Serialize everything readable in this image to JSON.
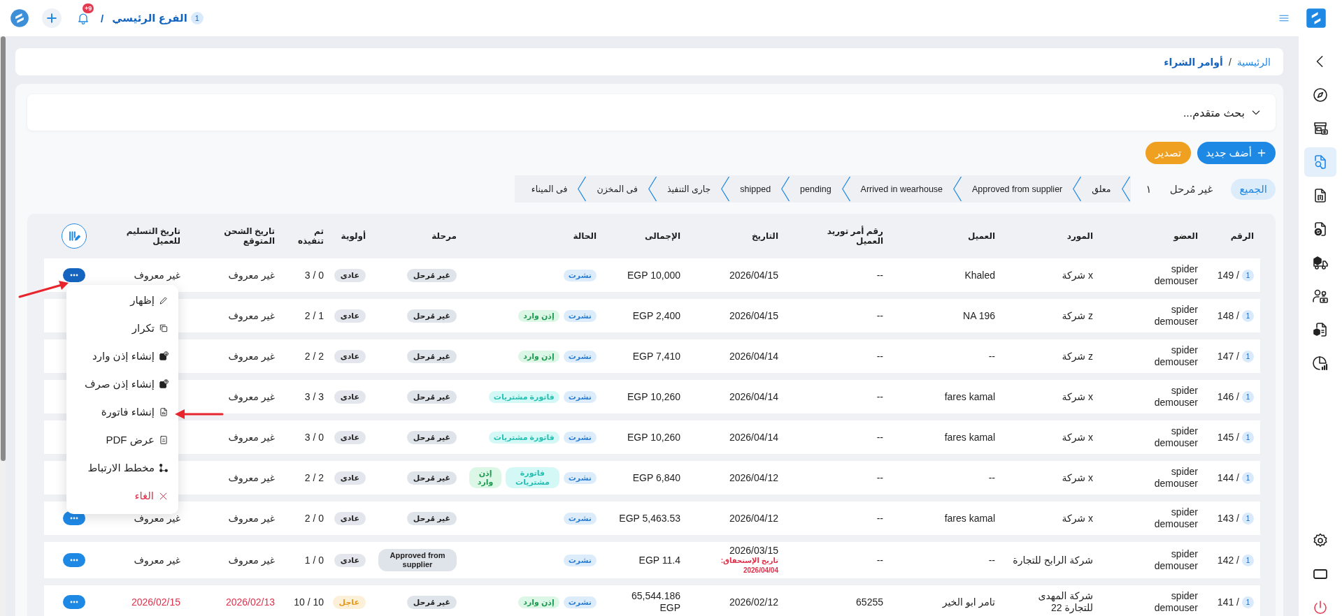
{
  "top_bar": {
    "notification_count": "+9",
    "separator": "/",
    "branch": "الفرع الرئيسي",
    "branch_count": "1"
  },
  "breadcrumb": {
    "items": [
      {
        "label": "الرئيسية",
        "kind": "link"
      },
      {
        "label": "أوامر الشراء",
        "kind": "current"
      }
    ],
    "separator": "/"
  },
  "advanced_search": {
    "label": "بحث متقدم...",
    "expanded": false
  },
  "toolbar": [
    {
      "label": "أضف جديد",
      "kind": "add"
    },
    {
      "label": "تصدير",
      "kind": "export"
    }
  ],
  "filters": {
    "tabs": [
      {
        "label": "الجميع",
        "selected": true
      },
      {
        "label": "غير مُرحل",
        "selected": false,
        "count": "١"
      }
    ],
    "steps": [
      {
        "label": "معلق",
        "selected": false
      },
      {
        "label": "Approved from supplier",
        "selected": false
      },
      {
        "label": "Arrived in wearhouse",
        "selected": false
      },
      {
        "label": "pending",
        "selected": false
      },
      {
        "label": "shipped",
        "selected": false
      },
      {
        "label": "جارى التنفيذ",
        "selected": false
      },
      {
        "label": "فى المخزن",
        "selected": false
      },
      {
        "label": "فى الميناء",
        "selected": false
      }
    ]
  },
  "table": {
    "columns": [
      "الرقم",
      "العضو",
      "المورد",
      "العميل",
      "رقم أمر توريد العميل",
      "التاريخ",
      "الإجمالى",
      "الحالة",
      "مرحلة",
      "أولوية",
      "تم تنفيذه",
      "تاريخ الشحن المتوقع",
      "تاريخ التسليم للعميل"
    ],
    "rows": [
      {
        "number": "149 /",
        "badge": "1",
        "member": "spider demouser",
        "supplier": "شركة x",
        "customer": "Khaled",
        "customer_order": "--",
        "date": "2026/04/15",
        "total": "EGP 10,000",
        "tags": [
          {
            "label": "نشرت",
            "kind": "published"
          }
        ],
        "stage": {
          "label": "غير مُرحل",
          "kind": "plain"
        },
        "priority": {
          "label": "عادى",
          "kind": "normal"
        },
        "done": "3 / 0",
        "shipping_date": "غير معروف",
        "delivery_date": "غير معروف",
        "overdue": false,
        "menu_open": true
      },
      {
        "number": "148 /",
        "badge": "1",
        "member": "spider demouser",
        "supplier": "شركة z",
        "customer": "NA 196",
        "customer_order": "--",
        "date": "2026/04/15",
        "total": "EGP 2,400",
        "tags": [
          {
            "label": "نشرت",
            "kind": "published"
          },
          {
            "label": "إذن وارد",
            "kind": "receipt"
          }
        ],
        "stage": {
          "label": "غير مُرحل",
          "kind": "plain"
        },
        "priority": {
          "label": "عادى",
          "kind": "normal"
        },
        "done": "2 / 1",
        "shipping_date": "غير معروف",
        "overdue": false
      },
      {
        "number": "147 /",
        "badge": "1",
        "member": "spider demouser",
        "supplier": "شركة z",
        "customer": "--",
        "customer_order": "--",
        "date": "2026/04/14",
        "total": "EGP 7,410",
        "tags": [
          {
            "label": "نشرت",
            "kind": "published"
          },
          {
            "label": "إذن وارد",
            "kind": "receipt"
          }
        ],
        "stage": {
          "label": "غير مُرحل",
          "kind": "plain"
        },
        "priority": {
          "label": "عادى",
          "kind": "normal"
        },
        "done": "2 / 2",
        "shipping_date": "غير معروف",
        "overdue": false
      },
      {
        "number": "146 /",
        "badge": "1",
        "member": "spider demouser",
        "supplier": "شركة x",
        "customer": "fares kamal",
        "customer_order": "--",
        "date": "2026/04/14",
        "total": "EGP 10,260",
        "tags": [
          {
            "label": "نشرت",
            "kind": "published"
          },
          {
            "label": "فاتورة مشتريات",
            "kind": "invoice"
          }
        ],
        "stage": {
          "label": "غير مُرحل",
          "kind": "plain"
        },
        "priority": {
          "label": "عادى",
          "kind": "normal"
        },
        "done": "3 / 3",
        "shipping_date": "غير معروف",
        "overdue": false
      },
      {
        "number": "145 /",
        "badge": "1",
        "member": "spider demouser",
        "supplier": "شركة x",
        "customer": "fares kamal",
        "customer_order": "--",
        "date": "2026/04/14",
        "total": "EGP 10,260",
        "tags": [
          {
            "label": "نشرت",
            "kind": "published"
          },
          {
            "label": "فاتورة مشتريات",
            "kind": "invoice"
          }
        ],
        "stage": {
          "label": "غير مُرحل",
          "kind": "plain"
        },
        "priority": {
          "label": "عادى",
          "kind": "normal"
        },
        "done": "3 / 0",
        "shipping_date": "غير معروف",
        "overdue": false
      },
      {
        "number": "144 /",
        "badge": "1",
        "member": "spider demouser",
        "supplier": "شركة x",
        "customer": "--",
        "customer_order": "--",
        "date": "2026/04/12",
        "total": "EGP 6,840",
        "tags": [
          {
            "label": "نشرت",
            "kind": "published"
          },
          {
            "label": "فاتورة مشتريات",
            "kind": "invoice"
          },
          {
            "label": "إذن وارد",
            "kind": "receipt"
          }
        ],
        "stage": {
          "label": "غير مُرحل",
          "kind": "plain"
        },
        "priority": {
          "label": "عادى",
          "kind": "normal"
        },
        "done": "2 / 2",
        "shipping_date": "غير معروف",
        "overdue": false
      },
      {
        "number": "143 /",
        "badge": "1",
        "member": "spider demouser",
        "supplier": "شركة x",
        "customer": "fares kamal",
        "customer_order": "--",
        "date": "2026/04/12",
        "total": "EGP 5,463.53",
        "tags": [
          {
            "label": "نشرت",
            "kind": "published"
          }
        ],
        "stage": {
          "label": "غير مُرحل",
          "kind": "plain"
        },
        "priority": {
          "label": "عادى",
          "kind": "normal"
        },
        "done": "2 / 0",
        "shipping_date": "غير معروف",
        "delivery_date": "غير معروف",
        "overdue": false,
        "menu_open": false
      },
      {
        "number": "142 /",
        "badge": "1",
        "member": "spider demouser",
        "supplier": "شركة الرابح للتجارة",
        "customer": "--",
        "customer_order": "--",
        "date": "2026/03/15",
        "due_label": "تاريخ الإستحقاق:",
        "due_date": "2026/04/04",
        "total": "EGP 11.4",
        "tags": [
          {
            "label": "نشرت",
            "kind": "published"
          }
        ],
        "stage": {
          "label": "Approved from supplier",
          "kind": "approved"
        },
        "priority": {
          "label": "عادى",
          "kind": "normal"
        },
        "done": "1 / 0",
        "shipping_date": "غير معروف",
        "delivery_date": "غير معروف",
        "overdue": false,
        "menu_open": false
      },
      {
        "number": "141 /",
        "badge": "1",
        "member": "spider demouser",
        "supplier": "شركة المهدى للتجارة 22",
        "customer": "تامر ابو الخير",
        "customer_order": "65255",
        "date": "2026/02/12",
        "total": "65,544.186 EGP",
        "tags": [
          {
            "label": "نشرت",
            "kind": "published"
          },
          {
            "label": "إذن وارد",
            "kind": "receipt"
          }
        ],
        "stage": {
          "label": "غير مُرحل",
          "kind": "plain"
        },
        "priority": {
          "label": "عاجل",
          "kind": "urgent"
        },
        "done": "10 / 10",
        "shipping_date": "2026/02/13",
        "delivery_date": "2026/02/15",
        "overdue": true,
        "menu_open": false
      }
    ]
  },
  "row_menu": {
    "items": [
      {
        "label": "إظهار",
        "kind": "normal"
      },
      {
        "label": "تكرار",
        "kind": "normal"
      },
      {
        "label": "إنشاء إذن وارد",
        "kind": "normal"
      },
      {
        "label": "إنشاء إذن صرف",
        "kind": "normal"
      },
      {
        "label": "إنشاء فاتورة",
        "kind": "normal"
      },
      {
        "label": "عرض PDF",
        "kind": "normal"
      },
      {
        "label": "مخطط الارتباط",
        "kind": "normal"
      },
      {
        "label": "الغاء",
        "kind": "danger"
      }
    ]
  },
  "sidebar": {
    "items": [
      {
        "selected": false
      },
      {
        "selected": false
      },
      {
        "selected": true
      },
      {
        "selected": false
      },
      {
        "selected": false
      },
      {
        "selected": false
      },
      {
        "selected": false
      },
      {
        "selected": false
      },
      {
        "selected": false
      }
    ]
  }
}
